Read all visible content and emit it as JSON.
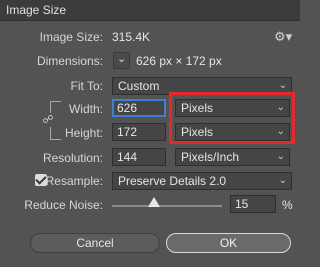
{
  "dialog": {
    "title": "Image Size",
    "image_size_label": "Image Size:",
    "image_size_value": "315.4K",
    "dimensions_label": "Dimensions:",
    "dimensions_value": "626 px  ×  172 px",
    "fit_to_label": "Fit To:",
    "fit_to_value": "Custom",
    "width_label": "Width:",
    "width_value": "626",
    "width_unit": "Pixels",
    "height_label": "Height:",
    "height_value": "172",
    "height_unit": "Pixels",
    "resolution_label": "Resolution:",
    "resolution_value": "144",
    "resolution_unit": "Pixels/Inch",
    "resample_label": "Resample:",
    "resample_checked": true,
    "resample_value": "Preserve Details 2.0",
    "reduce_noise_label": "Reduce Noise:",
    "reduce_noise_value": "15",
    "reduce_noise_unit": "%",
    "cancel_label": "Cancel",
    "ok_label": "OK"
  },
  "icons": {
    "settings": "gear-icon",
    "dimensions_toggle": "chevron-down-icon",
    "constrain": "link-icon"
  },
  "highlight_color": "#e5282a"
}
